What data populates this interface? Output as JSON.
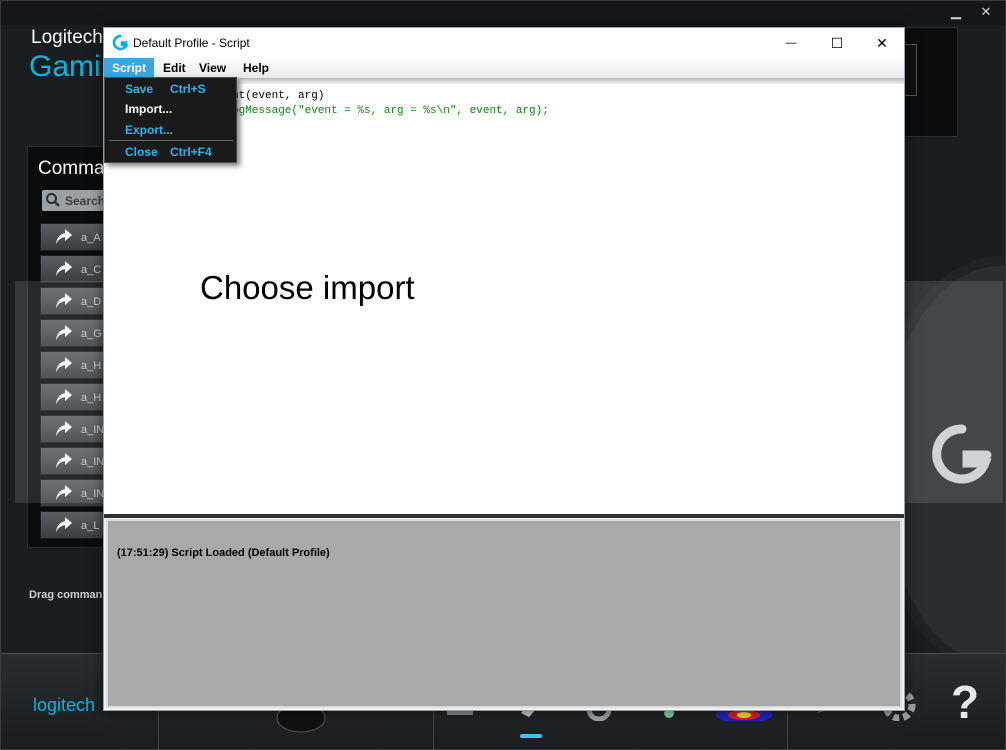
{
  "app": {
    "brand_top": "Logitech",
    "brand_bottom": "Gami",
    "commands_title": "Comma",
    "search_placeholder": "Search",
    "commands": [
      "a_A",
      "a_C",
      "a_D",
      "a_G",
      "a_H",
      "a_H",
      "a_IN",
      "a_IN",
      "a_IN",
      "a_L"
    ],
    "drag_hint": "Drag comman",
    "bottom_logo": "logitech",
    "help_glyph": "?"
  },
  "window": {
    "title": "Default Profile - Script",
    "minimize_glyph": "—",
    "maximize_glyph": "☐",
    "close_glyph": "✕"
  },
  "menu": {
    "items": [
      "Script",
      "Edit",
      "View",
      "Help"
    ],
    "active_index": 0
  },
  "dropdown": {
    "items": [
      {
        "label": "Save",
        "shortcut": "Ctrl+S",
        "color": "#27b4ee"
      },
      {
        "label": "Import...",
        "shortcut": "",
        "color": "#ffffff"
      },
      {
        "label": "Export...",
        "shortcut": "",
        "color": "#27b4ee"
      },
      {
        "label": "Close",
        "shortcut": "Ctrl+F4",
        "color": "#27b4ee"
      }
    ]
  },
  "editor": {
    "line1": "nt(event, arg)",
    "line2": "ogMessage(\"event = %s, arg = %s\\n\", event, arg);",
    "overlay_caption": "Choose import"
  },
  "output": {
    "message": "(17:51:29) Script Loaded (Default Profile)"
  },
  "colors": {
    "accent": "#00b8e6",
    "menu_active": "#3aa6e0",
    "code_green": "#118a11"
  }
}
